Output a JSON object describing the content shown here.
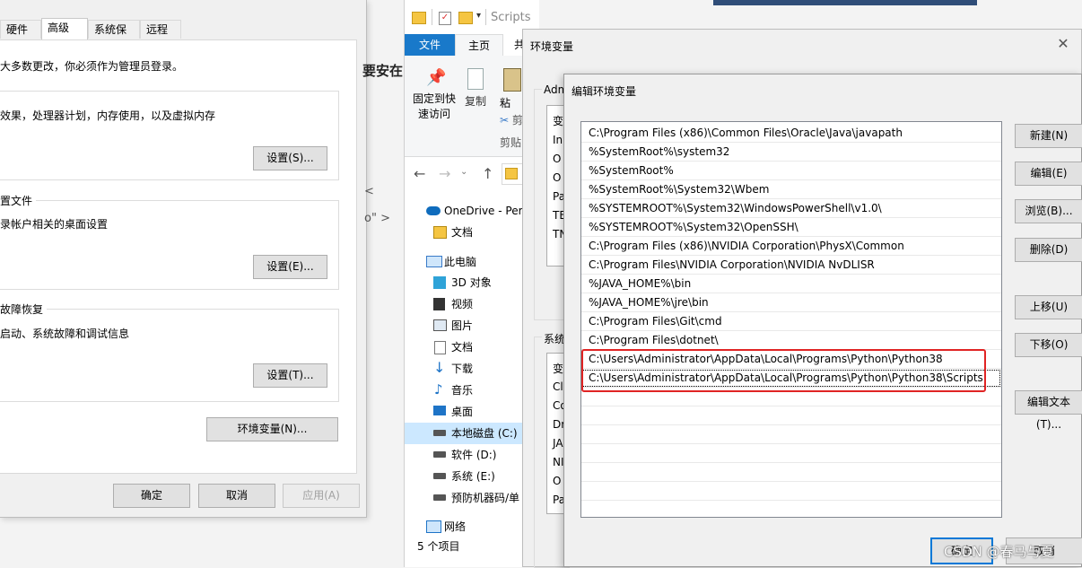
{
  "sysprops": {
    "tabs": [
      "硬件",
      "高级",
      "系统保护",
      "远程"
    ],
    "admin_note": "大多数更改，你必须作为管理员登录。",
    "perf_desc": "效果，处理器计划，内存使用，以及虚拟内存",
    "perf_settings": "设置(S)...",
    "profile_label": "置文件",
    "profile_desc": "录帐户相关的桌面设置",
    "profile_settings": "设置(E)...",
    "startup_label": "故障恢复",
    "startup_desc": "启动、系统故障和调试信息",
    "startup_settings": "设置(T)...",
    "env_button": "环境变量(N)...",
    "ok": "确定",
    "cancel": "取消",
    "apply": "应用(A)"
  },
  "background_text": {
    "install": "要安在",
    "chev1": "<",
    "chev2": "o\" >"
  },
  "explorer": {
    "window_title": "Scripts",
    "ribbon_tabs": [
      "文件",
      "主页",
      "共"
    ],
    "pin_label": "固定到快速访问",
    "copy_label": "复制",
    "paste_label": "粘",
    "cut_label": "剪",
    "clipboard_label": "剪贴",
    "tree": [
      {
        "label": "OneDrive - Pers",
        "icon": "onedrive-icon"
      },
      {
        "label": "文档",
        "icon": "documents-icon"
      },
      {
        "label": "此电脑",
        "icon": "pc-icon"
      },
      {
        "label": "3D 对象",
        "icon": "3d-objects-icon"
      },
      {
        "label": "视频",
        "icon": "video-icon"
      },
      {
        "label": "图片",
        "icon": "pictures-icon"
      },
      {
        "label": "文档",
        "icon": "documents-icon"
      },
      {
        "label": "下载",
        "icon": "download-icon"
      },
      {
        "label": "音乐",
        "icon": "music-icon"
      },
      {
        "label": "桌面",
        "icon": "desktop-icon"
      },
      {
        "label": "本地磁盘 (C:)",
        "icon": "drive-icon"
      },
      {
        "label": "软件 (D:)",
        "icon": "drive-icon"
      },
      {
        "label": "系统 (E:)",
        "icon": "drive-icon"
      },
      {
        "label": "预防机器码/单",
        "icon": "drive-icon"
      },
      {
        "label": "网络",
        "icon": "network-icon"
      }
    ],
    "status": "5 个项目"
  },
  "envdlg": {
    "title": "环境变量",
    "user_group": "Adm",
    "user_rows": [
      "变",
      "In",
      "O",
      "O",
      "Pa",
      "TE",
      "TN"
    ],
    "system_group": "系统",
    "system_rows": [
      "变",
      "Cl",
      "Co",
      "Dr",
      "JA",
      "NI",
      "O",
      "Pa"
    ]
  },
  "editdlg": {
    "title": "编辑环境变量",
    "paths": [
      "C:\\Program Files (x86)\\Common Files\\Oracle\\Java\\javapath",
      "%SystemRoot%\\system32",
      "%SystemRoot%",
      "%SystemRoot%\\System32\\Wbem",
      "%SYSTEMROOT%\\System32\\WindowsPowerShell\\v1.0\\",
      "%SYSTEMROOT%\\System32\\OpenSSH\\",
      "C:\\Program Files (x86)\\NVIDIA Corporation\\PhysX\\Common",
      "C:\\Program Files\\NVIDIA Corporation\\NVIDIA NvDLISR",
      "%JAVA_HOME%\\bin",
      "%JAVA_HOME%\\jre\\bin",
      "C:\\Program Files\\Git\\cmd",
      "C:\\Program Files\\dotnet\\",
      "C:\\Users\\Administrator\\AppData\\Local\\Programs\\Python\\Python38",
      "C:\\Users\\Administrator\\AppData\\Local\\Programs\\Python\\Python38\\Scripts"
    ],
    "buttons": {
      "new": "新建(N)",
      "edit": "编辑(E)",
      "browse": "浏览(B)...",
      "delete": "删除(D)",
      "up": "上移(U)",
      "down": "下移(O)",
      "edit_text": "编辑文本(T)..."
    },
    "ok_partial": "确定",
    "cancel_partial": "取消"
  },
  "watermark": "CSDN @春马与夏",
  "colors": {
    "highlight": "#e02424",
    "ribbon_file_tab": "#1979ca",
    "selection": "#cce8ff"
  }
}
